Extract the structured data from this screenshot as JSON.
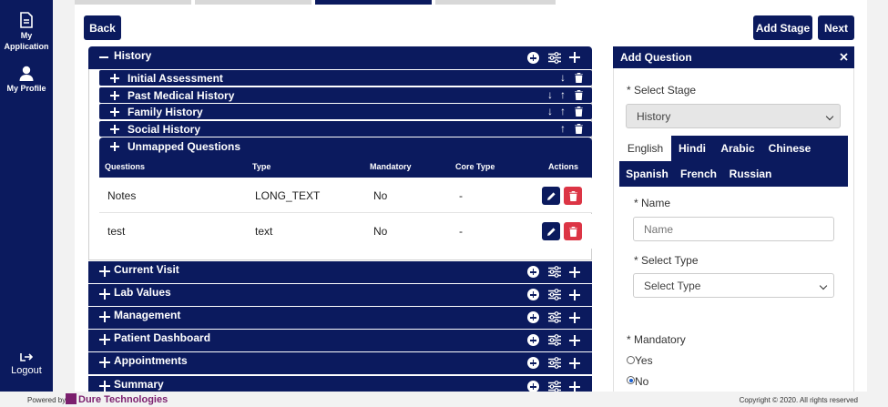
{
  "sidebar": {
    "items": [
      {
        "label_line1": "My",
        "label_line2": "Application",
        "icon": "document-icon"
      },
      {
        "label": "My Profile",
        "icon": "user-icon"
      }
    ],
    "logout": {
      "label": "Logout",
      "icon": "logout-icon"
    }
  },
  "toolbar": {
    "back_label": "Back",
    "add_stage_label": "Add Stage",
    "next_label": "Next"
  },
  "sections": {
    "history": {
      "title": "History",
      "subsections": [
        {
          "title": "Initial Assessment",
          "arrows": [
            "down"
          ]
        },
        {
          "title": "Past Medical History",
          "arrows": [
            "down",
            "up"
          ]
        },
        {
          "title": "Family History",
          "arrows": [
            "down",
            "up"
          ]
        },
        {
          "title": "Social History",
          "arrows": [
            "up"
          ]
        }
      ],
      "unmapped": {
        "title": "Unmapped Questions",
        "columns": [
          "Questions",
          "Type",
          "Mandatory",
          "Core Type",
          "Actions"
        ],
        "rows": [
          {
            "question": "Notes",
            "type": "LONG_TEXT",
            "mandatory": "No",
            "core_type": "-"
          },
          {
            "question": "test",
            "type": "text",
            "mandatory": "No",
            "core_type": "-"
          }
        ]
      }
    },
    "collapsed": [
      {
        "title": "Current Visit"
      },
      {
        "title": "Lab Values"
      },
      {
        "title": "Management"
      },
      {
        "title": "Patient Dashboard"
      },
      {
        "title": "Appointments"
      },
      {
        "title": "Summary"
      }
    ]
  },
  "panel": {
    "title": "Add Question",
    "select_stage_label": "* Select Stage",
    "select_stage_value": "History",
    "languages_row1": [
      "English",
      "Hindi",
      "Arabic",
      "Chinese"
    ],
    "languages_row2": [
      "Spanish",
      "French",
      "Russian"
    ],
    "name_label": "* Name",
    "name_placeholder": "Name",
    "select_type_label": "* Select Type",
    "select_type_value": "Select Type",
    "mandatory_label": "* Mandatory",
    "options": [
      {
        "label": "Yes",
        "checked": false
      },
      {
        "label": "No",
        "checked": true
      }
    ]
  },
  "footer": {
    "powered_by": "Powered by",
    "brand": "Dure Technologies",
    "copyright": "Copyright © 2020. All rights reserved"
  },
  "colors": {
    "primary": "#0b1a5e",
    "danger": "#dc3545",
    "brand_purple": "#7b1f6e"
  }
}
